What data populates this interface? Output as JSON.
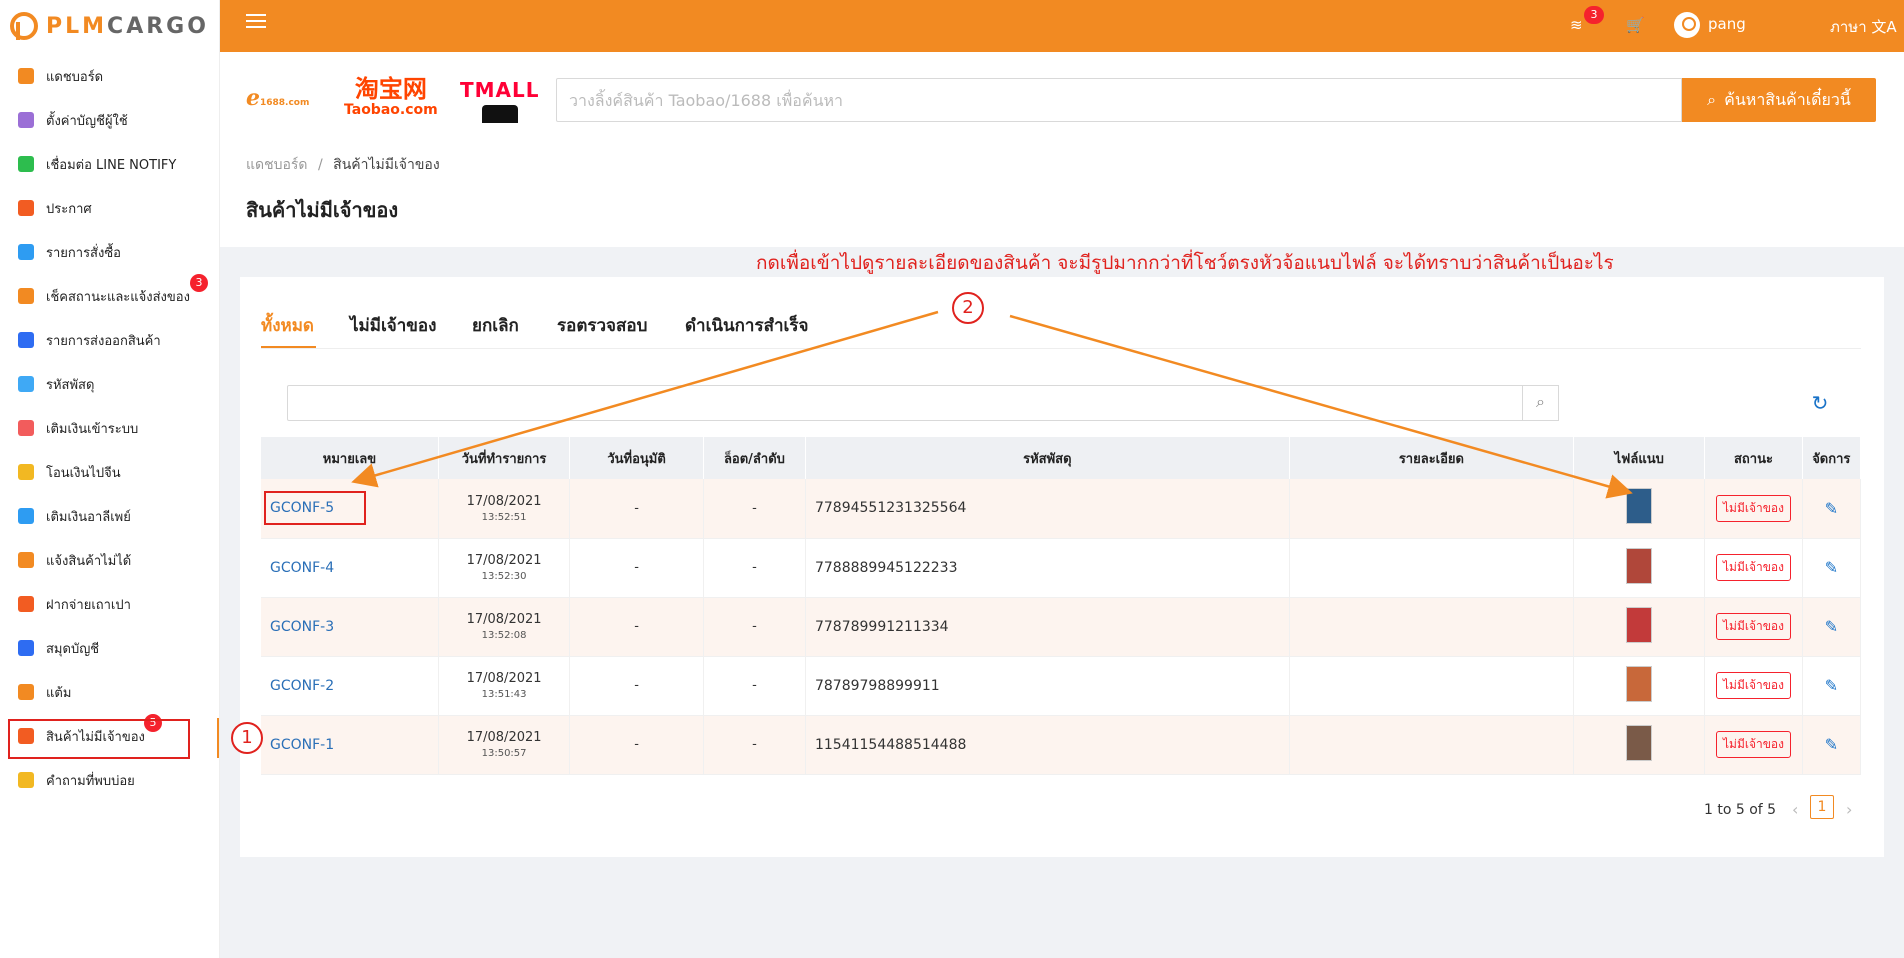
{
  "logo": {
    "part1": "PLM",
    "part2": "CARGO"
  },
  "sidebar": {
    "items": [
      {
        "label": "แดชบอร์ด",
        "icon": "chart-icon",
        "color": "#f28a22"
      },
      {
        "label": "ตั้งค่าบัญชีผู้ใช้",
        "icon": "user-settings-icon",
        "color": "#9b6fd6"
      },
      {
        "label": "เชื่อมต่อ LINE NOTIFY",
        "icon": "line-icon",
        "color": "#2dbd4e"
      },
      {
        "label": "ประกาศ",
        "icon": "megaphone-icon",
        "color": "#f25c22"
      },
      {
        "label": "รายการสั่งซื้อ",
        "icon": "basket-icon",
        "color": "#2e9cf2"
      },
      {
        "label": "เช็คสถานะและแจ้งส่งของ",
        "icon": "truck-icon",
        "color": "#f28a22",
        "badge": "3"
      },
      {
        "label": "รายการส่งออกสินค้า",
        "icon": "cart-icon",
        "color": "#2e6cf2"
      },
      {
        "label": "รหัสพัสดุ",
        "icon": "box-icon",
        "color": "#3fa9f5"
      },
      {
        "label": "เติมเงินเข้าระบบ",
        "icon": "piggy-bank-icon",
        "color": "#f25c5c"
      },
      {
        "label": "โอนเงินไปจีน",
        "icon": "yuan-icon",
        "color": "#f2b822"
      },
      {
        "label": "เติมเงินอาลีเพย์",
        "icon": "alipay-icon",
        "color": "#2e9cf2"
      },
      {
        "label": "แจ้งสินค้าไม่ได้",
        "icon": "report-icon",
        "color": "#f28a22"
      },
      {
        "label": "ฝากจ่ายเถาเปา",
        "icon": "taobao-icon",
        "color": "#f25c22"
      },
      {
        "label": "สมุดบัญชี",
        "icon": "wallet-icon",
        "color": "#2e6cf2"
      },
      {
        "label": "แต้ม",
        "icon": "medal-icon",
        "color": "#f28a22"
      },
      {
        "label": "สินค้าไม่มีเจ้าของ",
        "icon": "unowned-box-icon",
        "color": "#f25c22",
        "badge": "5",
        "active": true
      },
      {
        "label": "คำถามที่พบบ่อย",
        "icon": "question-icon",
        "color": "#f2b822"
      }
    ]
  },
  "header": {
    "stack_badge": "3",
    "username": "pang",
    "language": "ภาษา"
  },
  "search": {
    "brands": [
      "1688.com",
      "Taobao.com",
      "TMALL"
    ],
    "placeholder": "วางลิ้งค์สินค้า Taobao/1688 เพื่อค้นหา",
    "button_label": "ค้นหาสินค้าเดี๋ยวนี้"
  },
  "breadcrumb": {
    "home": "แดชบอร์ด",
    "separator": "/",
    "current": "สินค้าไม่มีเจ้าของ"
  },
  "page_title": "สินค้าไม่มีเจ้าของ",
  "annotation": {
    "note": "กดเพื่อเข้าไปดูรายละเอียดของสินค้า จะมีรูปมากกว่าที่โชว์ตรงหัวจ้อแนบไฟล์ จะได้ทราบว่าสินค้าเป็นอะไร",
    "marker1": "1",
    "marker2": "2"
  },
  "tabs": [
    {
      "label": "ทั้งหมด",
      "active": true
    },
    {
      "label": "ไม่มีเจ้าของ"
    },
    {
      "label": "ยกเลิก"
    },
    {
      "label": "รอตรวจสอบ"
    },
    {
      "label": "ดำเนินการสำเร็จ"
    }
  ],
  "table": {
    "columns": [
      "หมายเลข",
      "วันที่ทำรายการ",
      "วันที่อนุมัติ",
      "ล็อต/ลำดับ",
      "รหัสพัสดุ",
      "รายละเอียด",
      "ไฟล์แนบ",
      "สถานะ",
      "จัดการ"
    ],
    "rows": [
      {
        "code": "GCONF-5",
        "date": "17/08/2021",
        "time": "13:52:51",
        "approved": "-",
        "lot": "-",
        "parcel": "77894551231325564",
        "detail": "",
        "status": "ไม่มีเจ้าของ",
        "thumb_color": "#2d5d8a"
      },
      {
        "code": "GCONF-4",
        "date": "17/08/2021",
        "time": "13:52:30",
        "approved": "-",
        "lot": "-",
        "parcel": "7788889945122233",
        "detail": "",
        "status": "ไม่มีเจ้าของ",
        "thumb_color": "#b0473a"
      },
      {
        "code": "GCONF-3",
        "date": "17/08/2021",
        "time": "13:52:08",
        "approved": "-",
        "lot": "-",
        "parcel": "778789991211334",
        "detail": "",
        "status": "ไม่มีเจ้าของ",
        "thumb_color": "#c23a3a"
      },
      {
        "code": "GCONF-2",
        "date": "17/08/2021",
        "time": "13:51:43",
        "approved": "-",
        "lot": "-",
        "parcel": "78789798899911",
        "detail": "",
        "status": "ไม่มีเจ้าของ",
        "thumb_color": "#c8683a"
      },
      {
        "code": "GCONF-1",
        "date": "17/08/2021",
        "time": "13:50:57",
        "approved": "-",
        "lot": "-",
        "parcel": "11541154488514488",
        "detail": "",
        "status": "ไม่มีเจ้าของ",
        "thumb_color": "#7a5a48"
      }
    ]
  },
  "pagination": {
    "summary": "1 to 5 of 5",
    "current_page": "1"
  }
}
